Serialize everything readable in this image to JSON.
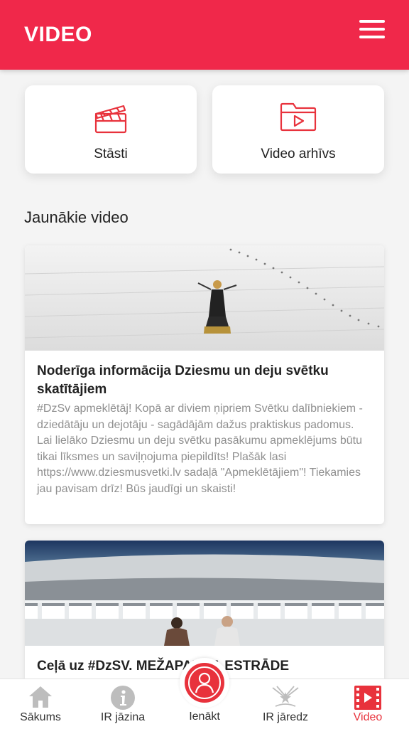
{
  "header": {
    "title": "VIDEO",
    "menu_icon": "hamburger-icon"
  },
  "tiles": [
    {
      "label": "Stāsti",
      "icon": "clapperboard-icon"
    },
    {
      "label": "Video arhīvs",
      "icon": "video-folder-icon"
    }
  ],
  "section_title": "Jaunākie video",
  "videos": [
    {
      "title": "Noderīga informācija Dziesmu un deju svētku skatītājiem",
      "description": "#DzSv apmeklētāj! Kopā ar diviem ņipriem Svētku dalībniekiem - dziedātāju un dejotāju - sagādājām dažus praktiskus padomus. Lai lielāko Dziesmu un deju svētku pasākumu apmeklējums būtu tikai līksmes un saviļņojuma piepildīts! Plašāk lasi https://www.dziesmusvetki.lv sadaļā \"Apmeklētājiem\"! Tiekamies jau pavisam drīz! Būs jaudīgi un skaisti!"
    },
    {
      "title": "Ceļā uz #DzSV. MEŽAPARKA ESTRĀDE",
      "description": ""
    }
  ],
  "bottom_nav": [
    {
      "label": "Sākums",
      "icon": "home-icon"
    },
    {
      "label": "IR jāzina",
      "icon": "info-icon"
    },
    {
      "label": "Ienākt",
      "icon": "user-login-icon"
    },
    {
      "label": "IR jāredz",
      "icon": "spotlight-icon"
    },
    {
      "label": "Video",
      "icon": "film-play-icon",
      "active": true
    }
  ],
  "colors": {
    "accent": "#f0284a",
    "active_nav": "#e8323c",
    "muted_text": "#8f8f8f"
  }
}
